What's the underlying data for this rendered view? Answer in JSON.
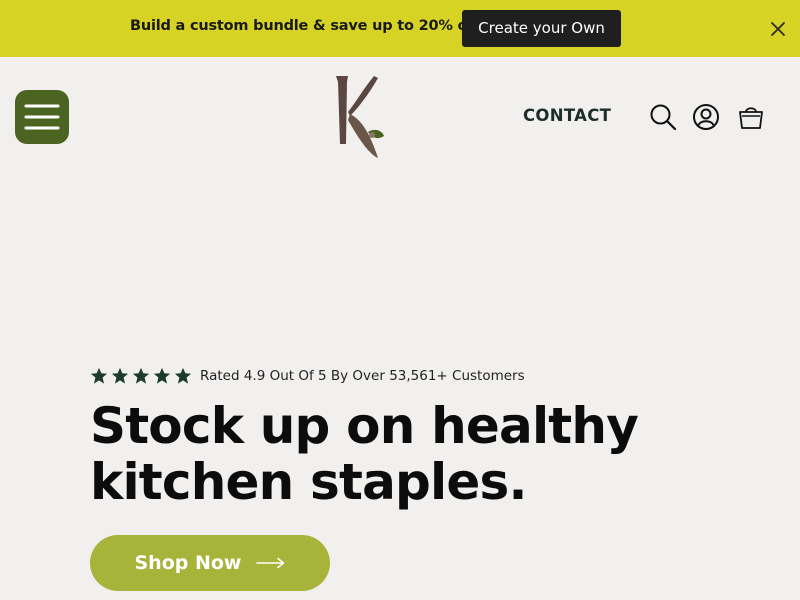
{
  "announcement": {
    "text": "Build a custom bundle & save up to 20% off",
    "cta_label": "Create your Own",
    "close_icon": "close-icon"
  },
  "header": {
    "menu_icon": "hamburger-menu-icon",
    "logo_icon": "brand-k-logo-icon",
    "nav": {
      "contact_label": "CONTACT"
    },
    "icons": [
      "search-icon",
      "account-icon",
      "cart-icon"
    ]
  },
  "hero": {
    "rating": {
      "stars": 5,
      "text": "Rated 4.9 Out Of 5 By Over 53,561+ Customers"
    },
    "headline_line1": "Stock up on healthy",
    "headline_line2": "kitchen staples.",
    "cta_label": "Shop Now",
    "cta_icon": "arrow-right-icon"
  },
  "colors": {
    "announcement_bg": "#d6d325",
    "cta_dark": "#1f1f1f",
    "menu_green": "#4c6421",
    "shop_button": "#a8b33a",
    "page_bg": "#f1f0ee",
    "star_color": "#1d3b2c",
    "logo_brown": "#5a4741"
  }
}
